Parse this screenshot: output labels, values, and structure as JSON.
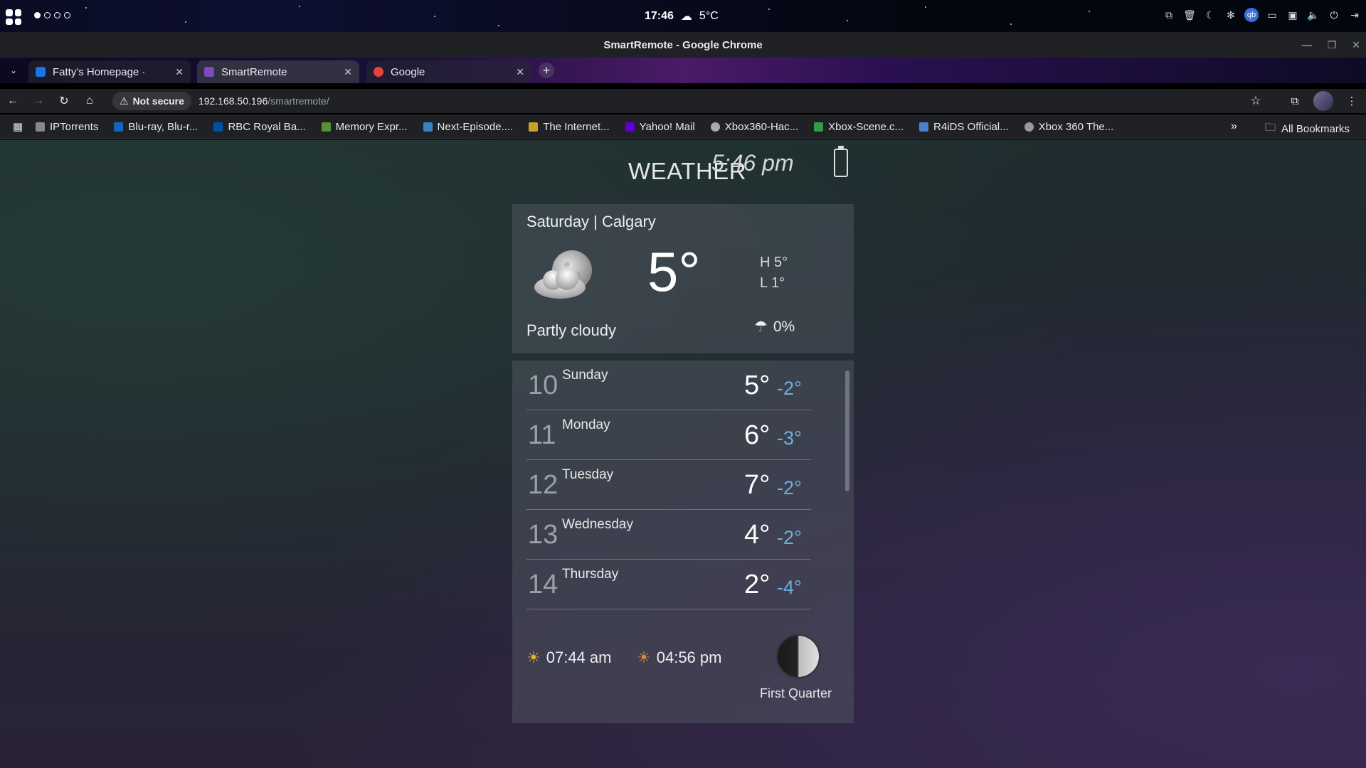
{
  "os": {
    "clock": "17:46",
    "weather_temp": "5°C",
    "user_badge": "qb"
  },
  "window": {
    "title": "SmartRemote - Google Chrome"
  },
  "tabs": [
    {
      "label": "Fatty's Homepage ·",
      "favicon_color": "#1a73e8"
    },
    {
      "label": "SmartRemote",
      "favicon_color": "#7b4bc2"
    },
    {
      "label": "Google",
      "favicon_color": "#ea4335"
    }
  ],
  "address": {
    "security_label": "Not secure",
    "host": "192.168.50.196",
    "path": "/smartremote/"
  },
  "bookmarks": [
    {
      "label": "IPTorrents",
      "color": "#888888"
    },
    {
      "label": "Blu-ray, Blu-r...",
      "color": "#1565c0"
    },
    {
      "label": "RBC Royal Ba...",
      "color": "#0051a5"
    },
    {
      "label": "Memory Expr...",
      "color": "#5a8f3a"
    },
    {
      "label": "Next-Episode....",
      "color": "#3b82c4"
    },
    {
      "label": "The Internet...",
      "color": "#c9a227"
    },
    {
      "label": "Yahoo! Mail",
      "color": "#6001d2"
    },
    {
      "label": "Xbox360-Hac...",
      "color": "#aaaaaa"
    },
    {
      "label": "Xbox-Scene.c...",
      "color": "#2e9e47"
    },
    {
      "label": "R4iDS Official...",
      "color": "#4a7fd4"
    },
    {
      "label": "Xbox 360 The...",
      "color": "#999999"
    }
  ],
  "all_bookmarks_label": "All Bookmarks",
  "weather": {
    "header": "WEATHER",
    "time": "5:46 pm",
    "day_city": "Saturday | Calgary",
    "temp": "5°",
    "high": "H 5°",
    "low": "L 1°",
    "condition": "Partly cloudy",
    "precip": "0%",
    "forecast": [
      {
        "date": "10",
        "day": "Sunday",
        "hi": "5°",
        "lo": "-2°"
      },
      {
        "date": "11",
        "day": "Monday",
        "hi": "6°",
        "lo": "-3°"
      },
      {
        "date": "12",
        "day": "Tuesday",
        "hi": "7°",
        "lo": "-2°"
      },
      {
        "date": "13",
        "day": "Wednesday",
        "hi": "4°",
        "lo": "-2°"
      },
      {
        "date": "14",
        "day": "Thursday",
        "hi": "2°",
        "lo": "-4°"
      }
    ],
    "sunrise": "07:44 am",
    "sunset": "04:56 pm",
    "moon_phase": "First Quarter"
  }
}
